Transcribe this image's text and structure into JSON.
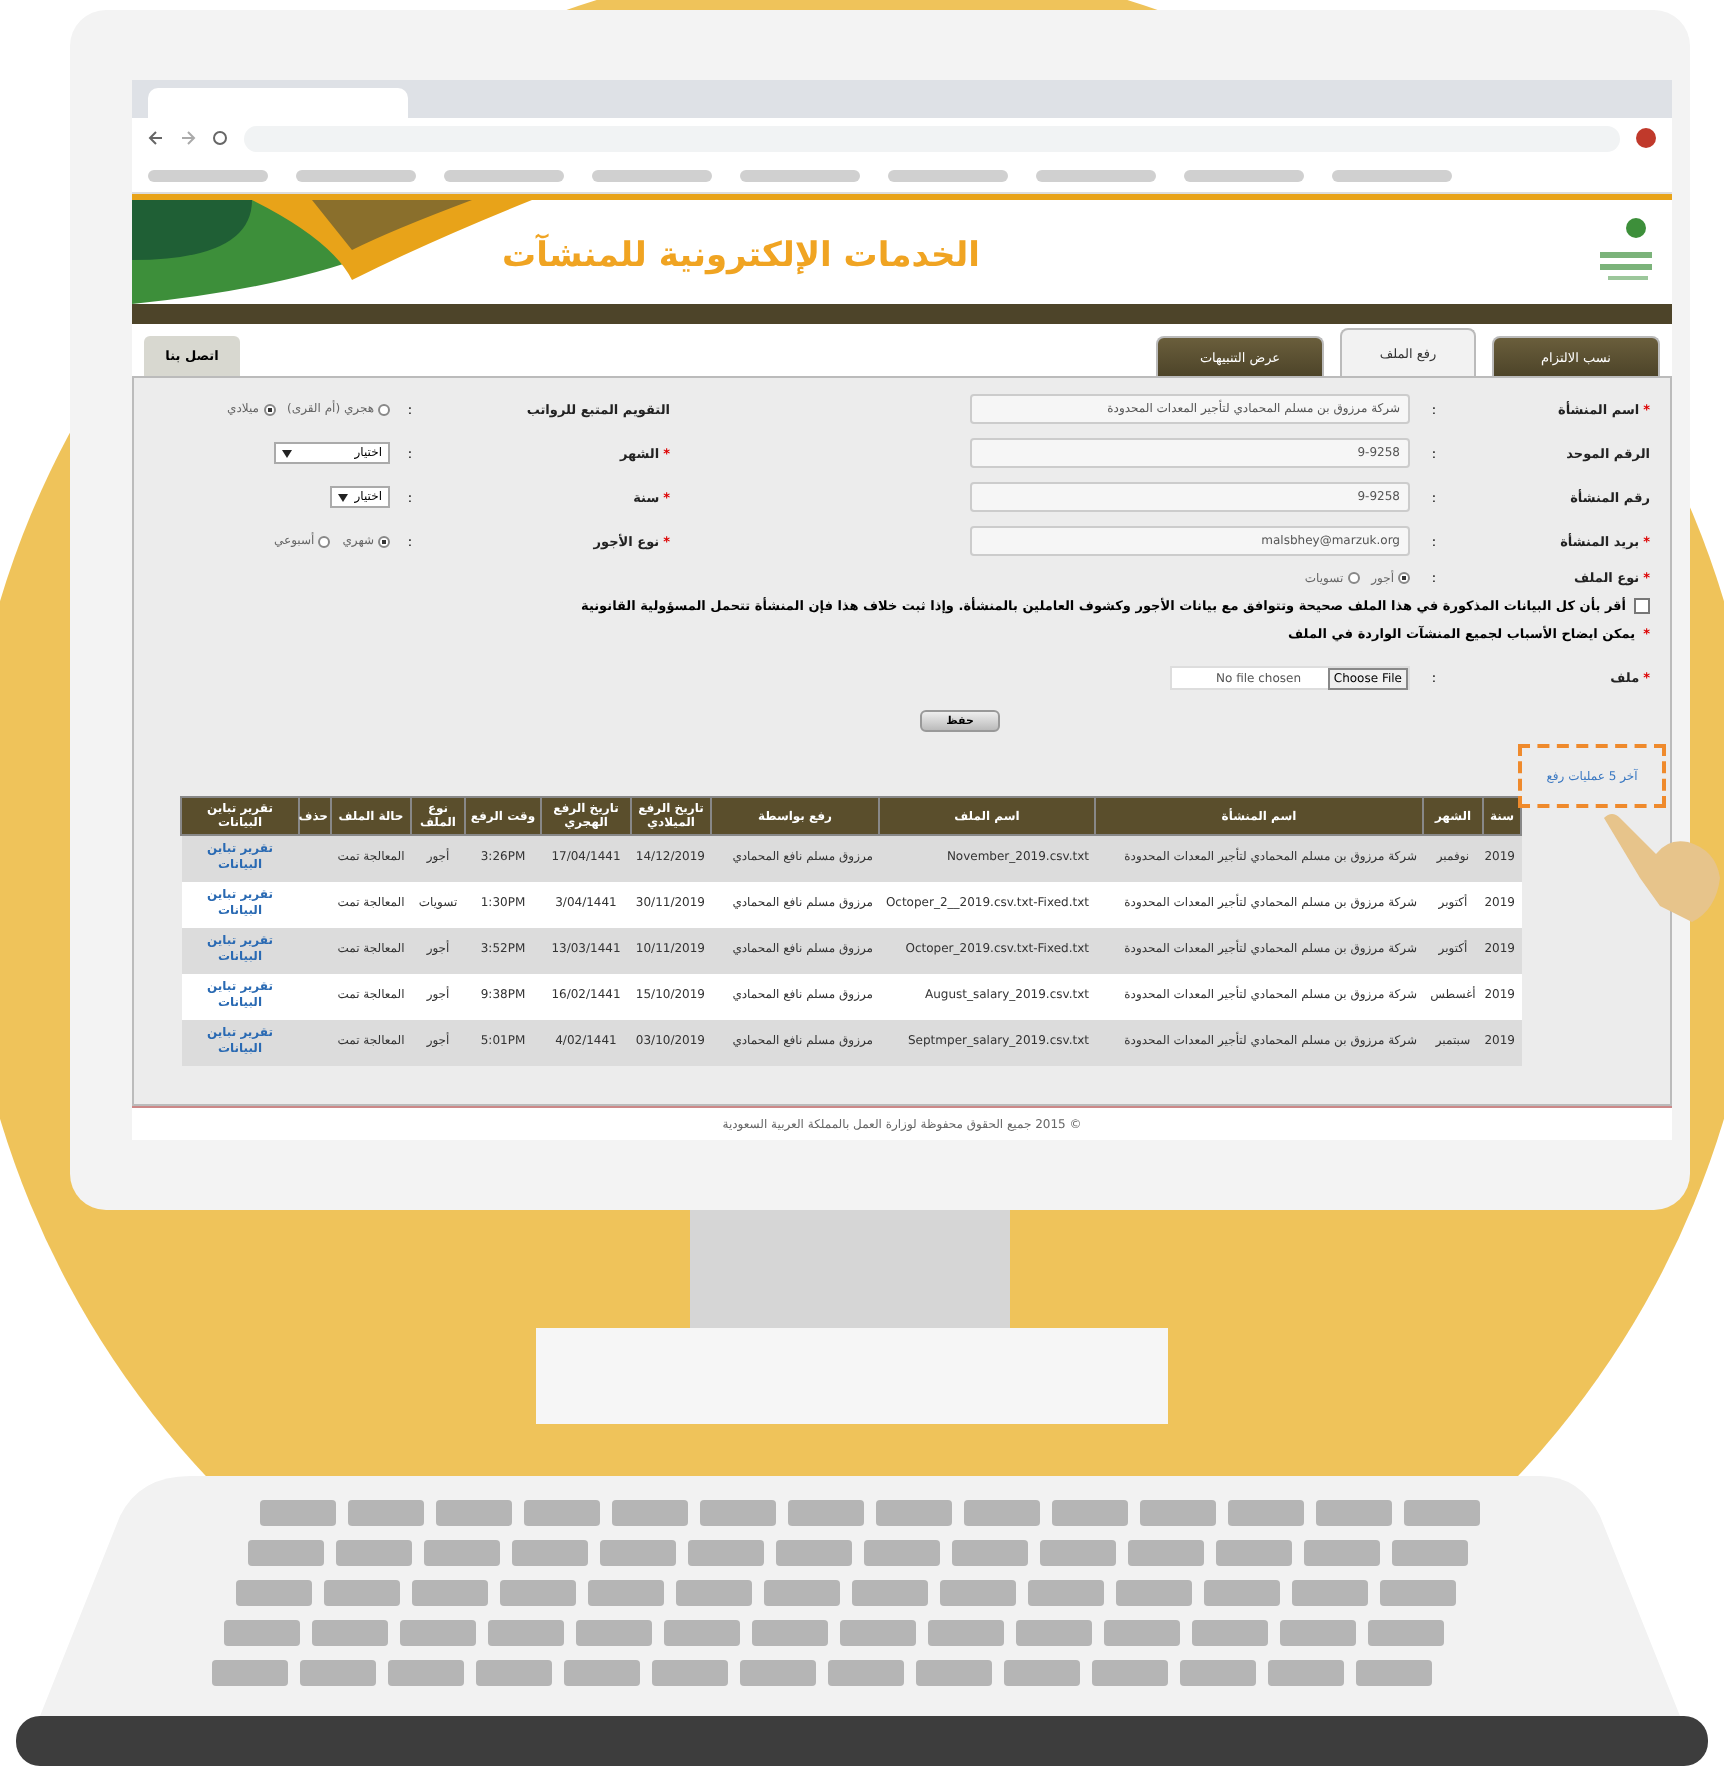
{
  "header": {
    "title": "الخدمات الإلكترونية للمنشآت"
  },
  "tabs": [
    {
      "label": "نسب الالتزام",
      "selected": false
    },
    {
      "label": "رفع الملف",
      "selected": true
    },
    {
      "label": "عرض التنبيهات",
      "selected": false
    }
  ],
  "contact_button": "اتصل بنا",
  "form": {
    "rows": [
      {
        "right": {
          "kind": "text",
          "label": "اسم المنشأة",
          "marker": "*",
          "colon": ":",
          "value": "شركة مرزوق بن مسلم المحمادي لتأجير المعدات المحدودة"
        },
        "left": {
          "kind": "radio",
          "label": "التقويم المتبع للرواتب",
          "colon": ":",
          "options": [
            {
              "label": "هجري (أم القرى)",
              "selected": false
            },
            {
              "label": "ميلادي",
              "selected": true
            }
          ]
        }
      },
      {
        "right": {
          "kind": "text",
          "label": "الرقم الموحد",
          "colon": ":",
          "value": "9-9258"
        },
        "left": {
          "kind": "select",
          "label": "الشهر",
          "marker": "*",
          "colon": ":",
          "value": "اختيار"
        }
      },
      {
        "right": {
          "kind": "text",
          "label": "رقم المنشأة",
          "colon": ":",
          "value": "9-9258"
        },
        "left": {
          "kind": "select",
          "label": "سنة",
          "marker": "*",
          "colon": ":",
          "value": "اختيار"
        }
      },
      {
        "right": {
          "kind": "text",
          "label": "بريد المنشأة",
          "marker": "*",
          "colon": ":",
          "value": "malsbhey@marzuk.org"
        },
        "left": {
          "kind": "radio",
          "label": "نوع الأجور",
          "marker": "*",
          "colon": ":",
          "options": [
            {
              "label": "شهري",
              "selected": true
            },
            {
              "label": "أسبوعي",
              "selected": false
            }
          ]
        }
      },
      {
        "right": {
          "kind": "radio",
          "label": "نوع الملف",
          "marker": "*",
          "colon": ":",
          "options": [
            {
              "label": "أجور",
              "selected": true
            },
            {
              "label": "تسويات",
              "selected": false
            }
          ]
        }
      }
    ],
    "declaration": {
      "text": "أقر بأن كل البيانات المذكورة في هذا الملف صحيحة وتتوافق مع بيانات الأجور وكشوف العاملين بالمنشأة. وإذا ثبت خلاف هذا فإن المنشأة تتحمل المسؤولية القانونية",
      "checked": false
    },
    "note": {
      "marker": "*",
      "text": "يمكن ايضاح الأسباب لجميع المنشآت الواردة في الملف"
    },
    "file": {
      "label": "ملف",
      "marker": "*",
      "colon": ":",
      "button": "Choose File",
      "status": "No file chosen"
    },
    "save_button": "حفظ"
  },
  "recent_link": "آخر 5 عمليات رفع",
  "table": {
    "columns": [
      "سنة",
      "الشهر",
      "اسم المنشأة",
      "اسم الملف",
      "رفع بواسطة",
      "تاريخ الرفع الميلادي",
      "تاريخ الرفع الهجري",
      "وقت الرفع",
      "نوع الملف",
      "حالة الملف",
      "حذف",
      "تقرير تباين البيانات"
    ],
    "rows": [
      [
        "2019",
        "نوفمبر",
        "شركة مرزوق بن مسلم المحمادي لتأجير المعدات المحدودة",
        "November_2019.csv.txt",
        "مرزوق مسلم نافع المحمادي",
        "14/12/2019",
        "17/04/1441",
        "3:26PM",
        "أجور",
        "المعالجة تمت",
        "",
        "تقرير تباين البيانات"
      ],
      [
        "2019",
        "أكتوبر",
        "شركة مرزوق بن مسلم المحمادي لتأجير المعدات المحدودة",
        "Octoper_2__2019.csv.txt-Fixed.txt",
        "مرزوق مسلم نافع المحمادي",
        "30/11/2019",
        "3/04/1441",
        "1:30PM",
        "تسويات",
        "المعالجة تمت",
        "",
        "تقرير تباين البيانات"
      ],
      [
        "2019",
        "أكتوبر",
        "شركة مرزوق بن مسلم المحمادي لتأجير المعدات المحدودة",
        "Octoper_2019.csv.txt-Fixed.txt",
        "مرزوق مسلم نافع المحمادي",
        "10/11/2019",
        "13/03/1441",
        "3:52PM",
        "أجور",
        "المعالجة تمت",
        "",
        "تقرير تباين البيانات"
      ],
      [
        "2019",
        "أغسطس",
        "شركة مرزوق بن مسلم المحمادي لتأجير المعدات المحدودة",
        "August_salary_2019.csv.txt",
        "مرزوق مسلم نافع المحمادي",
        "15/10/2019",
        "16/02/1441",
        "9:38PM",
        "أجور",
        "المعالجة تمت",
        "",
        "تقرير تباين البيانات"
      ],
      [
        "2019",
        "سبتمبر",
        "شركة مرزوق بن مسلم المحمادي لتأجير المعدات المحدودة",
        "Septmper_salary_2019.csv.txt",
        "مرزوق مسلم نافع المحمادي",
        "03/10/2019",
        "4/02/1441",
        "5:01PM",
        "أجور",
        "المعالجة تمت",
        "",
        "تقرير تباين البيانات"
      ]
    ]
  },
  "footer": "© 2015 جميع الحقوق محفوظة لوزارة العمل بالمملكة العربية السعودية"
}
